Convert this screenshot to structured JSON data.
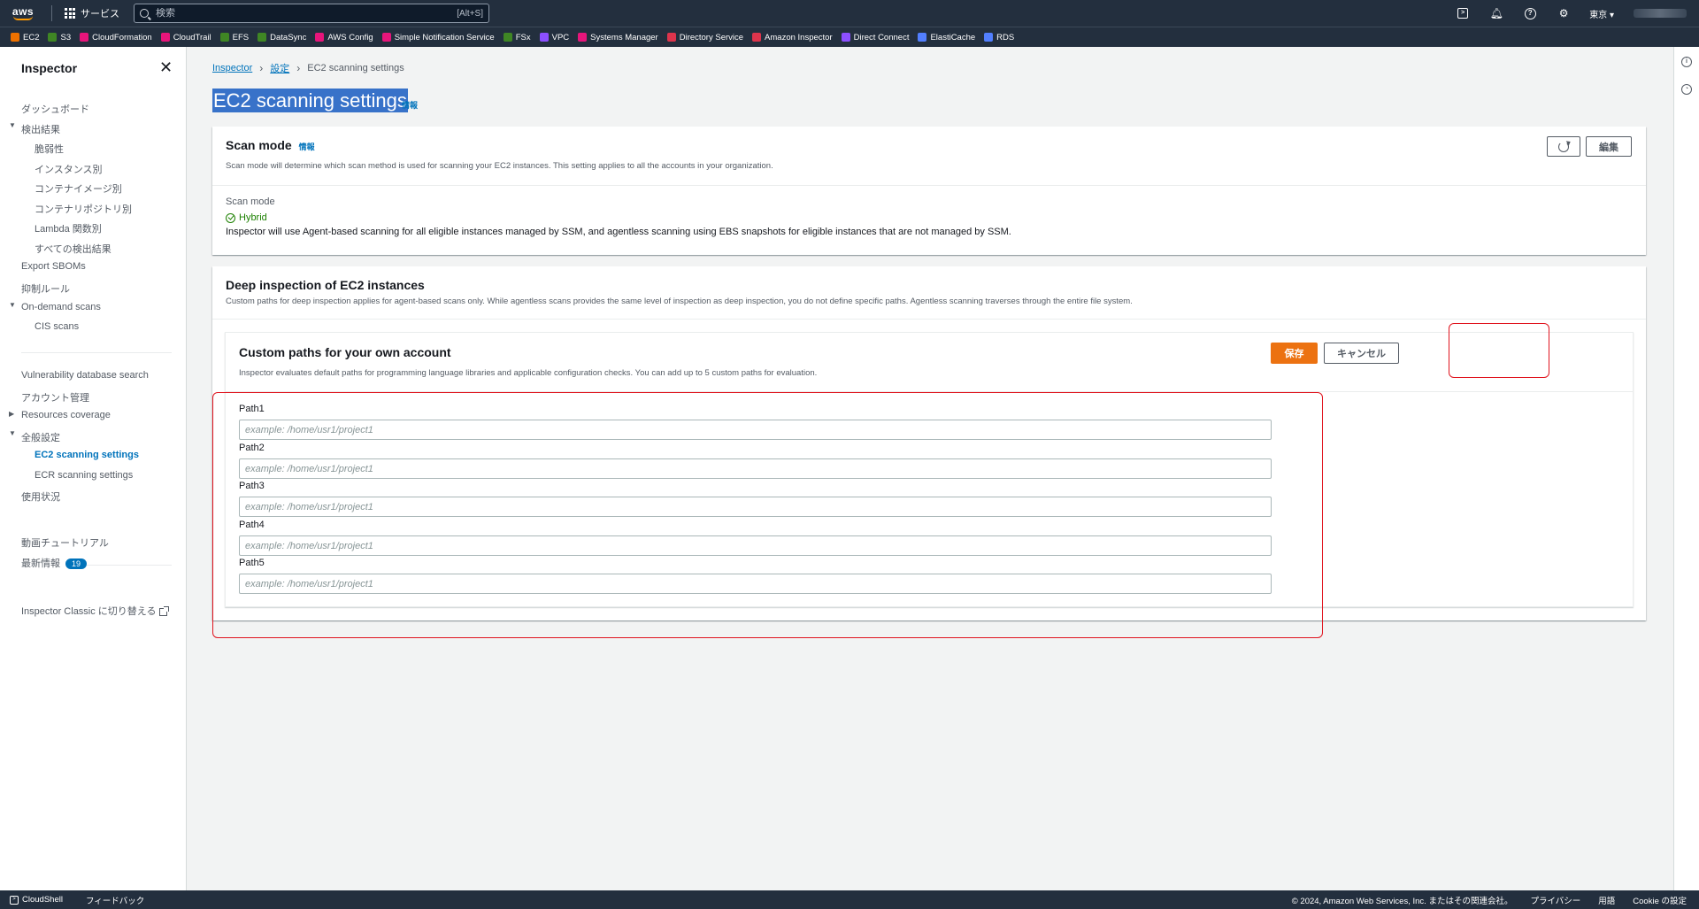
{
  "topnav": {
    "logo": "aws",
    "services_label": "サービス",
    "search_placeholder": "検索",
    "search_hint": "[Alt+S]",
    "region": "東京 ▾",
    "icons": [
      "cloudshell-icon",
      "bell-icon",
      "help-icon",
      "settings-icon"
    ]
  },
  "favorites": [
    {
      "label": "EC2",
      "color": "#ed7100"
    },
    {
      "label": "S3",
      "color": "#3f8624"
    },
    {
      "label": "CloudFormation",
      "color": "#e7157b"
    },
    {
      "label": "CloudTrail",
      "color": "#e7157b"
    },
    {
      "label": "EFS",
      "color": "#3f8624"
    },
    {
      "label": "DataSync",
      "color": "#3f8624"
    },
    {
      "label": "AWS Config",
      "color": "#e7157b"
    },
    {
      "label": "Simple Notification Service",
      "color": "#e7157b"
    },
    {
      "label": "FSx",
      "color": "#3f8624"
    },
    {
      "label": "VPC",
      "color": "#8c4fff"
    },
    {
      "label": "Systems Manager",
      "color": "#e7157b"
    },
    {
      "label": "Directory Service",
      "color": "#dd344c"
    },
    {
      "label": "Amazon Inspector",
      "color": "#dd344c"
    },
    {
      "label": "Direct Connect",
      "color": "#8c4fff"
    },
    {
      "label": "ElastiCache",
      "color": "#527fff"
    },
    {
      "label": "RDS",
      "color": "#527fff"
    }
  ],
  "sidebar": {
    "title": "Inspector",
    "items": {
      "dashboard": "ダッシュボード",
      "findings": "検出結果",
      "vulnerabilities": "脆弱性",
      "by_instance": "インスタンス別",
      "by_container_image": "コンテナイメージ別",
      "by_container_repo": "コンテナリポジトリ別",
      "by_lambda": "Lambda 関数別",
      "all_findings": "すべての検出結果",
      "export_sboms": "Export SBOMs",
      "suppression_rules": "抑制ルール",
      "on_demand_scans": "On-demand scans",
      "cis_scans": "CIS scans",
      "vuln_db_search": "Vulnerability database search",
      "account_management": "アカウント管理",
      "resources_coverage": "Resources coverage",
      "general_settings": "全般設定",
      "ec2_scanning_settings": "EC2 scanning settings",
      "ecr_scanning_settings": "ECR scanning settings",
      "usage": "使用状況",
      "video_tutorials": "動画チュートリアル",
      "whats_new": "最新情報",
      "whats_new_count": "19",
      "switch_classic": "Inspector Classic に切り替える"
    }
  },
  "breadcrumb": {
    "root": "Inspector",
    "settings": "設定",
    "current": "EC2 scanning settings"
  },
  "page": {
    "title": "EC2 scanning settings",
    "info": "情報"
  },
  "scan_mode": {
    "title": "Scan mode",
    "info": "情報",
    "description": "Scan mode will determine which scan method is used for scanning your EC2 instances. This setting applies to all the accounts in your organization.",
    "edit_label": "編集",
    "field_label": "Scan mode",
    "value": "Hybrid",
    "value_description": "Inspector will use Agent-based scanning for all eligible instances managed by SSM, and agentless scanning using EBS snapshots for eligible instances that are not managed by SSM."
  },
  "deep_inspection": {
    "title": "Deep inspection of EC2 instances",
    "description": "Custom paths for deep inspection applies for agent-based scans only. While agentless scans provides the same level of inspection as deep inspection, you do not define specific paths. Agentless scanning traverses through the entire file system.",
    "custom_paths": {
      "title": "Custom paths for your own account",
      "description": "Inspector evaluates default paths for programming language libraries and applicable configuration checks. You can add up to 5 custom paths for evaluation.",
      "save_label": "保存",
      "cancel_label": "キャンセル",
      "paths": [
        {
          "label": "Path1",
          "value": "",
          "placeholder": "example: /home/usr1/project1"
        },
        {
          "label": "Path2",
          "value": "",
          "placeholder": "example: /home/usr1/project1"
        },
        {
          "label": "Path3",
          "value": "",
          "placeholder": "example: /home/usr1/project1"
        },
        {
          "label": "Path4",
          "value": "",
          "placeholder": "example: /home/usr1/project1"
        },
        {
          "label": "Path5",
          "value": "",
          "placeholder": "example: /home/usr1/project1"
        }
      ]
    }
  },
  "footer": {
    "cloudshell": "CloudShell",
    "feedback": "フィードバック",
    "copyright": "© 2024, Amazon Web Services, Inc. またはその関連会社。",
    "privacy": "プライバシー",
    "terms": "用語",
    "cookie": "Cookie の設定"
  },
  "colors": {
    "nav_bg": "#232f3e",
    "link": "#0073bb",
    "primary_button": "#ec7211",
    "success": "#1d8102",
    "highlight_box": "#e0141e"
  }
}
